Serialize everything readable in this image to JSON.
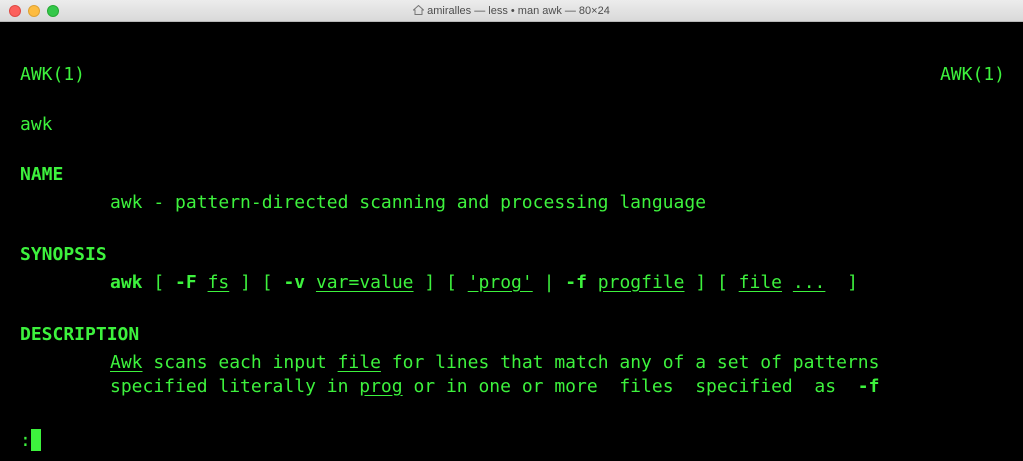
{
  "window": {
    "title": "amiralles — less • man awk — 80×24",
    "traffic_lights": [
      "close",
      "minimize",
      "zoom"
    ]
  },
  "colors": {
    "foreground": "#3df23d",
    "background": "#000000"
  },
  "man": {
    "header_left": "AWK(1)",
    "header_right": "AWK(1)",
    "command": "awk",
    "name_heading": "NAME",
    "name_desc": "awk - pattern-directed scanning and processing language",
    "synopsis_heading": "SYNOPSIS",
    "synopsis": {
      "cmd": "awk",
      "bracket_open_1": " [ ",
      "opt_F": "-F",
      "fs": "fs",
      "close_open_1": " ] [ ",
      "opt_v": "-v",
      "var": "var=value",
      "close_open_2": " ] [ ",
      "prog": "'prog'",
      "pipe": " | ",
      "opt_f": "-f",
      "progfile": "progfile",
      "close_open_3": " ] [ ",
      "file": "file",
      "ellipsis": "...",
      "close_final": "  ]"
    },
    "description_heading": "DESCRIPTION",
    "desc1": {
      "awk": "Awk",
      "part1": " scans each input ",
      "file": "file",
      "part2": " for lines that match any of a set of patterns"
    },
    "desc2": {
      "part1": "specified literally in ",
      "prog": "prog",
      "part2": " or in one or more  files  specified  as  ",
      "opt_f": "-f"
    },
    "prompt": ":"
  }
}
